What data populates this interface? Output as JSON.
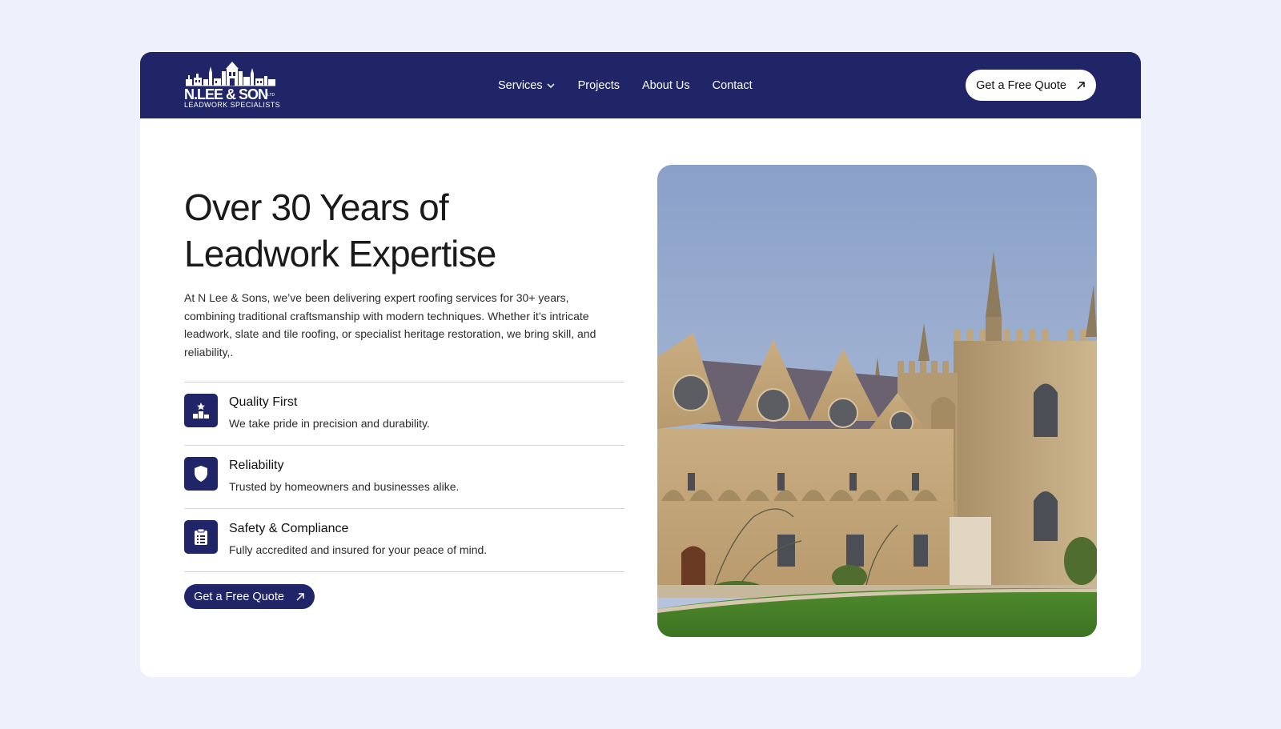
{
  "nav": {
    "logo": {
      "brand": "N.LEE & SON",
      "ltd": "LTD",
      "tagline": "LEADWORK SPECIALISTS"
    },
    "menu": [
      {
        "label": "Services",
        "has_dropdown": true
      },
      {
        "label": "Projects"
      },
      {
        "label": "About Us"
      },
      {
        "label": "Contact"
      }
    ],
    "cta_label": "Get a Free Quote"
  },
  "hero": {
    "headline_line1": "Over 30 Years of",
    "headline_line2": "Leadwork Expertise",
    "intro": "At N Lee & Sons, we’ve been delivering expert roofing services for 30+ years, combining traditional craftsmanship with modern techniques. Whether it’s intricate leadwork, slate and tile roofing, or specialist heritage restoration, we bring skill, and reliability,.",
    "features": [
      {
        "title": "Quality First",
        "desc": "We take pride in precision and durability.",
        "icon": "podium-star-icon"
      },
      {
        "title": "Reliability",
        "desc": "Trusted by homeowners and businesses alike.",
        "icon": "shield-icon"
      },
      {
        "title": "Safety & Compliance",
        "desc": "Fully accredited and insured for your peace of mind.",
        "icon": "clipboard-icon"
      }
    ],
    "cta_label": "Get a Free Quote",
    "image": "gothic-college-building-photo"
  },
  "colors": {
    "page_bg": "#eef0fc",
    "navy": "#1f2566",
    "card_bg": "#ffffff"
  }
}
